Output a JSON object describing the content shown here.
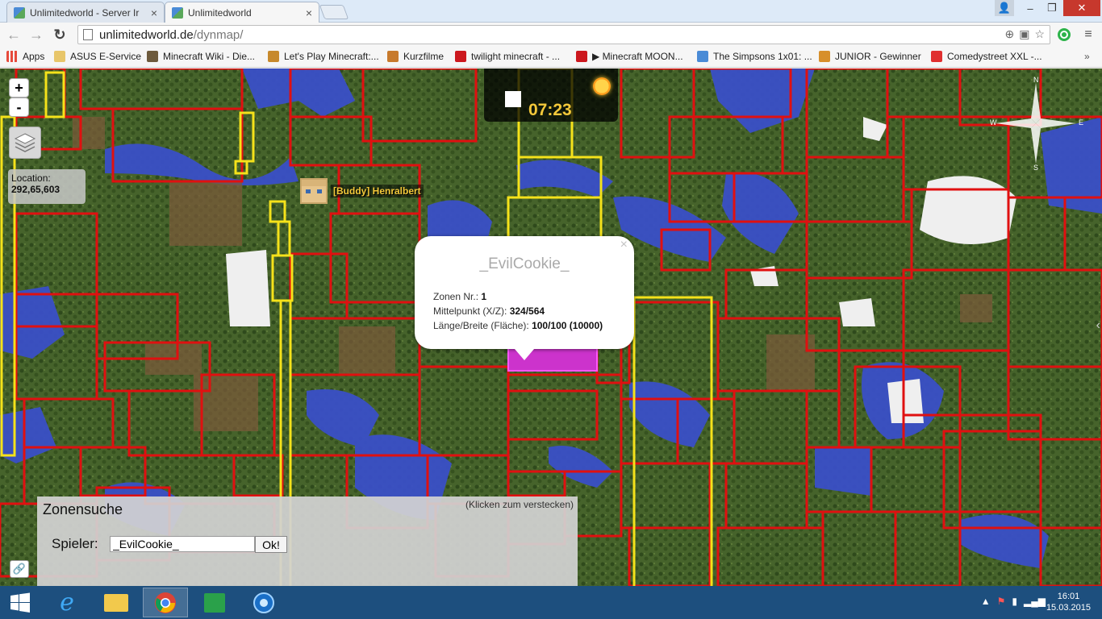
{
  "browser": {
    "tabs": [
      {
        "title": "Unlimitedworld - Server Ir",
        "close": "×"
      },
      {
        "title": "Unlimitedworld",
        "close": "×"
      }
    ],
    "window_buttons": {
      "user": "👤",
      "minimize": "–",
      "restore": "❐",
      "close": "✕"
    },
    "url_host": "unlimitedworld.de",
    "url_path": "/dynmap/",
    "bookmarks": [
      {
        "label": "Apps",
        "icon": "apps-grid-icon",
        "color": "#e64a3b"
      },
      {
        "label": "ASUS E-Service",
        "icon": "folder-icon",
        "color": "#e8c66a"
      },
      {
        "label": "Minecraft Wiki - Die...",
        "icon": "grass-block-icon",
        "color": "#6d5a3c"
      },
      {
        "label": "Let's Play Minecraft:...",
        "icon": "game-icon",
        "color": "#c7892c"
      },
      {
        "label": "Kurzfilme",
        "icon": "film-icon",
        "color": "#c77a2c"
      },
      {
        "label": "twilight minecraft - ...",
        "icon": "youtube-icon",
        "color": "#cc181e"
      },
      {
        "label": "▶ Minecraft MOON...",
        "icon": "youtube-icon",
        "color": "#cc181e"
      },
      {
        "label": "The Simpsons 1x01: ...",
        "icon": "tv-icon",
        "color": "#4a8bd6"
      },
      {
        "label": "JUNIOR - Gewinner",
        "icon": "junior-icon",
        "color": "#d78f2b"
      },
      {
        "label": "Comedystreet XXL -...",
        "icon": "comedy-icon",
        "color": "#e02f2f"
      }
    ]
  },
  "map": {
    "zoom_in": "+",
    "zoom_out": "-",
    "location_label": "Location:",
    "location_coords": "292,65,603",
    "time": "07:23",
    "player_name": "[Buddy] Henralbert",
    "compass": {
      "n": "N",
      "e": "E",
      "s": "S",
      "w": "W"
    },
    "popup": {
      "title": "_EvilCookie_",
      "close": "×",
      "zone_label": "Zonen Nr.:",
      "zone_value": "1",
      "center_label": "Mittelpunkt (X/Z):",
      "center_value": "324/564",
      "size_label": "Länge/Breite (Fläche):",
      "size_value": "100/100 (10000)"
    },
    "zone_search": {
      "title": "Zonensuche",
      "hide": "(Klicken zum verstecken)",
      "player_label": "Spieler:",
      "player_value": "_EvilCookie_",
      "ok": "Ok!"
    }
  },
  "taskbar": {
    "time": "16:01",
    "date": "15.03.2015"
  },
  "colors": {
    "zone_red": "#e01010",
    "zone_yellow": "#f5e21a",
    "zone_magenta": "#cc33cc",
    "taskbar": "#1d4f7e"
  }
}
